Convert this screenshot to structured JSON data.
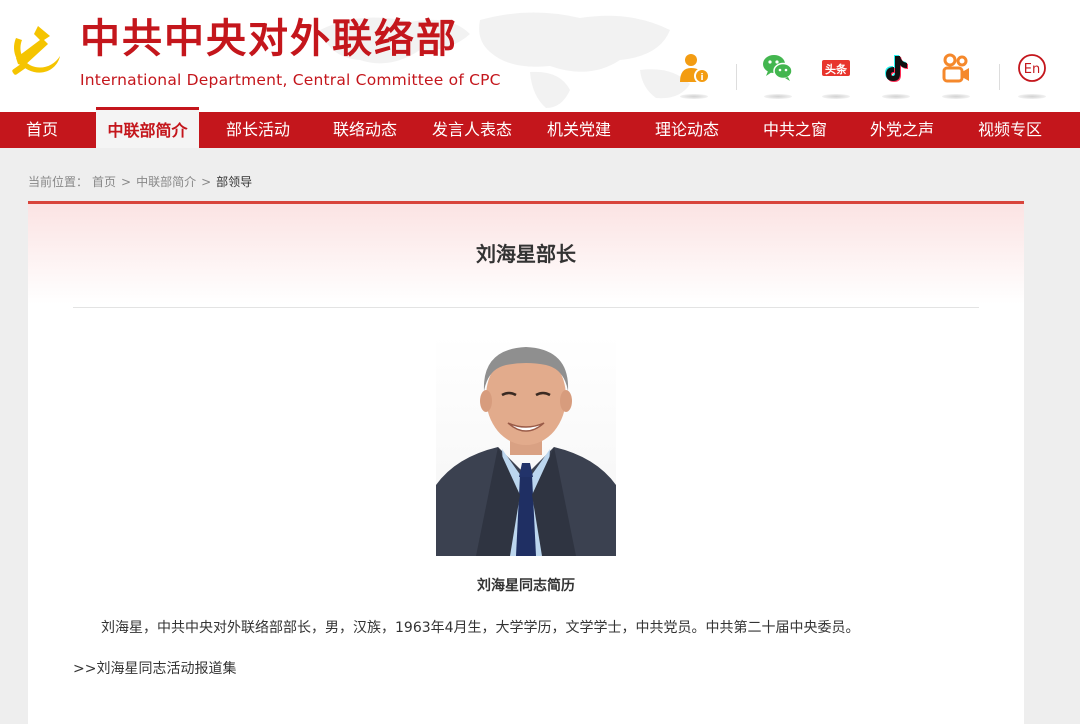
{
  "header": {
    "title_cn": "中共中央对外联络部",
    "title_en": "International Department, Central Committee of CPC",
    "social": [
      {
        "icon": "person-info-icon",
        "color": "#f39c12"
      },
      {
        "icon": "wechat-icon",
        "color": "#43b64f"
      },
      {
        "icon": "toutiao-icon",
        "label": "头条",
        "color": "#e8352d"
      },
      {
        "icon": "douyin-icon",
        "color": "#111111"
      },
      {
        "icon": "kuaishou-icon",
        "color": "#f5882b"
      },
      {
        "icon": "english-icon",
        "label": "En",
        "color": "#c4161c"
      }
    ]
  },
  "nav": {
    "items": [
      "首页",
      "中联部简介",
      "部长活动",
      "联络动态",
      "发言人表态",
      "机关党建",
      "理论动态",
      "中共之窗",
      "外党之声",
      "视频专区"
    ],
    "active": "中联部简介"
  },
  "breadcrumb": {
    "label": "当前位置：",
    "items": [
      "首页",
      "中联部简介",
      "部领导"
    ],
    "separator": ">"
  },
  "article": {
    "title": "刘海星部长",
    "photo_caption": "刘海星同志简历",
    "bio": "刘海星，中共中央对外联络部部长，男，汉族，1963年4月生，大学学历，文学学士，中共党员。中共第二十届中央委员。",
    "more_link": ">>刘海星同志活动报道集"
  },
  "colors": {
    "brand_red": "#c4161c",
    "card_top_border": "#d8443b",
    "page_bg": "#eeeeee"
  }
}
